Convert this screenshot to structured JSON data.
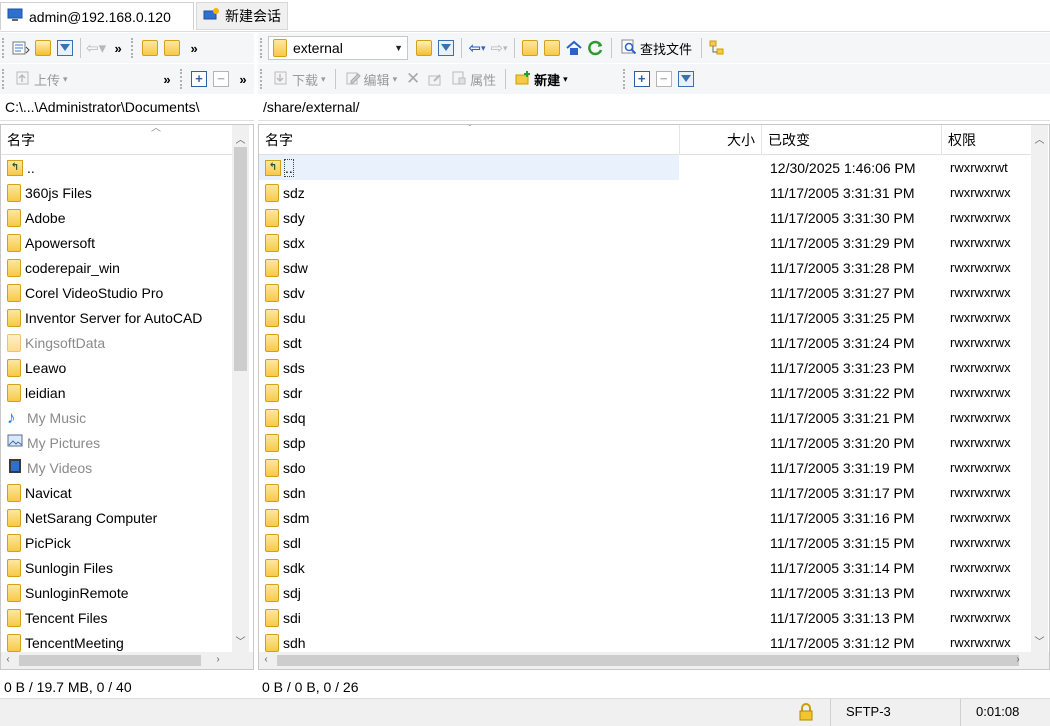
{
  "tabs": [
    {
      "label": "admin@192.168.0.120",
      "icon": "monitor-icon"
    },
    {
      "label": "新建会话",
      "icon": "new-session-icon"
    }
  ],
  "left_toolbar": {
    "upload_label": "上传",
    "more": "»"
  },
  "right_toolbar": {
    "location": "external",
    "find_files_label": "查找文件",
    "download_label": "下载",
    "edit_label": "编辑",
    "properties_label": "属性",
    "new_label": "新建",
    "more": "»"
  },
  "left_pane": {
    "path": "C:\\...\\Administrator\\Documents\\",
    "column_name": "名字",
    "rows": [
      {
        "name": "..",
        "kind": "up"
      },
      {
        "name": "360js Files",
        "kind": "folder"
      },
      {
        "name": "Adobe",
        "kind": "folder"
      },
      {
        "name": "Apowersoft",
        "kind": "folder"
      },
      {
        "name": "coderepair_win",
        "kind": "folder"
      },
      {
        "name": "Corel VideoStudio Pro",
        "kind": "folder"
      },
      {
        "name": "Inventor Server for AutoCAD",
        "kind": "folder"
      },
      {
        "name": "KingsoftData",
        "kind": "folder-gray"
      },
      {
        "name": "Leawo",
        "kind": "folder"
      },
      {
        "name": "leidian",
        "kind": "folder"
      },
      {
        "name": "My Music",
        "kind": "music"
      },
      {
        "name": "My Pictures",
        "kind": "pictures"
      },
      {
        "name": "My Videos",
        "kind": "videos"
      },
      {
        "name": "Navicat",
        "kind": "folder"
      },
      {
        "name": "NetSarang Computer",
        "kind": "folder"
      },
      {
        "name": "PicPick",
        "kind": "folder"
      },
      {
        "name": "Sunlogin Files",
        "kind": "folder"
      },
      {
        "name": "SunloginRemote",
        "kind": "folder"
      },
      {
        "name": "Tencent Files",
        "kind": "folder"
      },
      {
        "name": "TencentMeeting",
        "kind": "folder"
      }
    ],
    "status": "0 B / 19.7 MB,  0 / 40"
  },
  "right_pane": {
    "path": "/share/external/",
    "columns": {
      "name": "名字",
      "size": "大小",
      "modified": "已改变",
      "permissions": "权限"
    },
    "rows": [
      {
        "name": "..",
        "size": "",
        "modified": "12/30/2025 1:46:06 PM",
        "permissions": "rwxrwxrwt",
        "kind": "up"
      },
      {
        "name": "sdz",
        "size": "",
        "modified": "11/17/2005 3:31:31 PM",
        "permissions": "rwxrwxrwx",
        "kind": "folder"
      },
      {
        "name": "sdy",
        "size": "",
        "modified": "11/17/2005 3:31:30 PM",
        "permissions": "rwxrwxrwx",
        "kind": "folder"
      },
      {
        "name": "sdx",
        "size": "",
        "modified": "11/17/2005 3:31:29 PM",
        "permissions": "rwxrwxrwx",
        "kind": "folder"
      },
      {
        "name": "sdw",
        "size": "",
        "modified": "11/17/2005 3:31:28 PM",
        "permissions": "rwxrwxrwx",
        "kind": "folder"
      },
      {
        "name": "sdv",
        "size": "",
        "modified": "11/17/2005 3:31:27 PM",
        "permissions": "rwxrwxrwx",
        "kind": "folder"
      },
      {
        "name": "sdu",
        "size": "",
        "modified": "11/17/2005 3:31:25 PM",
        "permissions": "rwxrwxrwx",
        "kind": "folder"
      },
      {
        "name": "sdt",
        "size": "",
        "modified": "11/17/2005 3:31:24 PM",
        "permissions": "rwxrwxrwx",
        "kind": "folder"
      },
      {
        "name": "sds",
        "size": "",
        "modified": "11/17/2005 3:31:23 PM",
        "permissions": "rwxrwxrwx",
        "kind": "folder"
      },
      {
        "name": "sdr",
        "size": "",
        "modified": "11/17/2005 3:31:22 PM",
        "permissions": "rwxrwxrwx",
        "kind": "folder"
      },
      {
        "name": "sdq",
        "size": "",
        "modified": "11/17/2005 3:31:21 PM",
        "permissions": "rwxrwxrwx",
        "kind": "folder"
      },
      {
        "name": "sdp",
        "size": "",
        "modified": "11/17/2005 3:31:20 PM",
        "permissions": "rwxrwxrwx",
        "kind": "folder"
      },
      {
        "name": "sdo",
        "size": "",
        "modified": "11/17/2005 3:31:19 PM",
        "permissions": "rwxrwxrwx",
        "kind": "folder"
      },
      {
        "name": "sdn",
        "size": "",
        "modified": "11/17/2005 3:31:17 PM",
        "permissions": "rwxrwxrwx",
        "kind": "folder"
      },
      {
        "name": "sdm",
        "size": "",
        "modified": "11/17/2005 3:31:16 PM",
        "permissions": "rwxrwxrwx",
        "kind": "folder"
      },
      {
        "name": "sdl",
        "size": "",
        "modified": "11/17/2005 3:31:15 PM",
        "permissions": "rwxrwxrwx",
        "kind": "folder"
      },
      {
        "name": "sdk",
        "size": "",
        "modified": "11/17/2005 3:31:14 PM",
        "permissions": "rwxrwxrwx",
        "kind": "folder"
      },
      {
        "name": "sdj",
        "size": "",
        "modified": "11/17/2005 3:31:13 PM",
        "permissions": "rwxrwxrwx",
        "kind": "folder"
      },
      {
        "name": "sdi",
        "size": "",
        "modified": "11/17/2005 3:31:13 PM",
        "permissions": "rwxrwxrwx",
        "kind": "folder"
      },
      {
        "name": "sdh",
        "size": "",
        "modified": "11/17/2005 3:31:12 PM",
        "permissions": "rwxrwxrwx",
        "kind": "folder"
      }
    ],
    "status": "0 B / 0 B,  0 / 26"
  },
  "bottom_bar": {
    "protocol": "SFTP-3",
    "timer": "0:01:08",
    "lock_icon": "lock-icon"
  }
}
